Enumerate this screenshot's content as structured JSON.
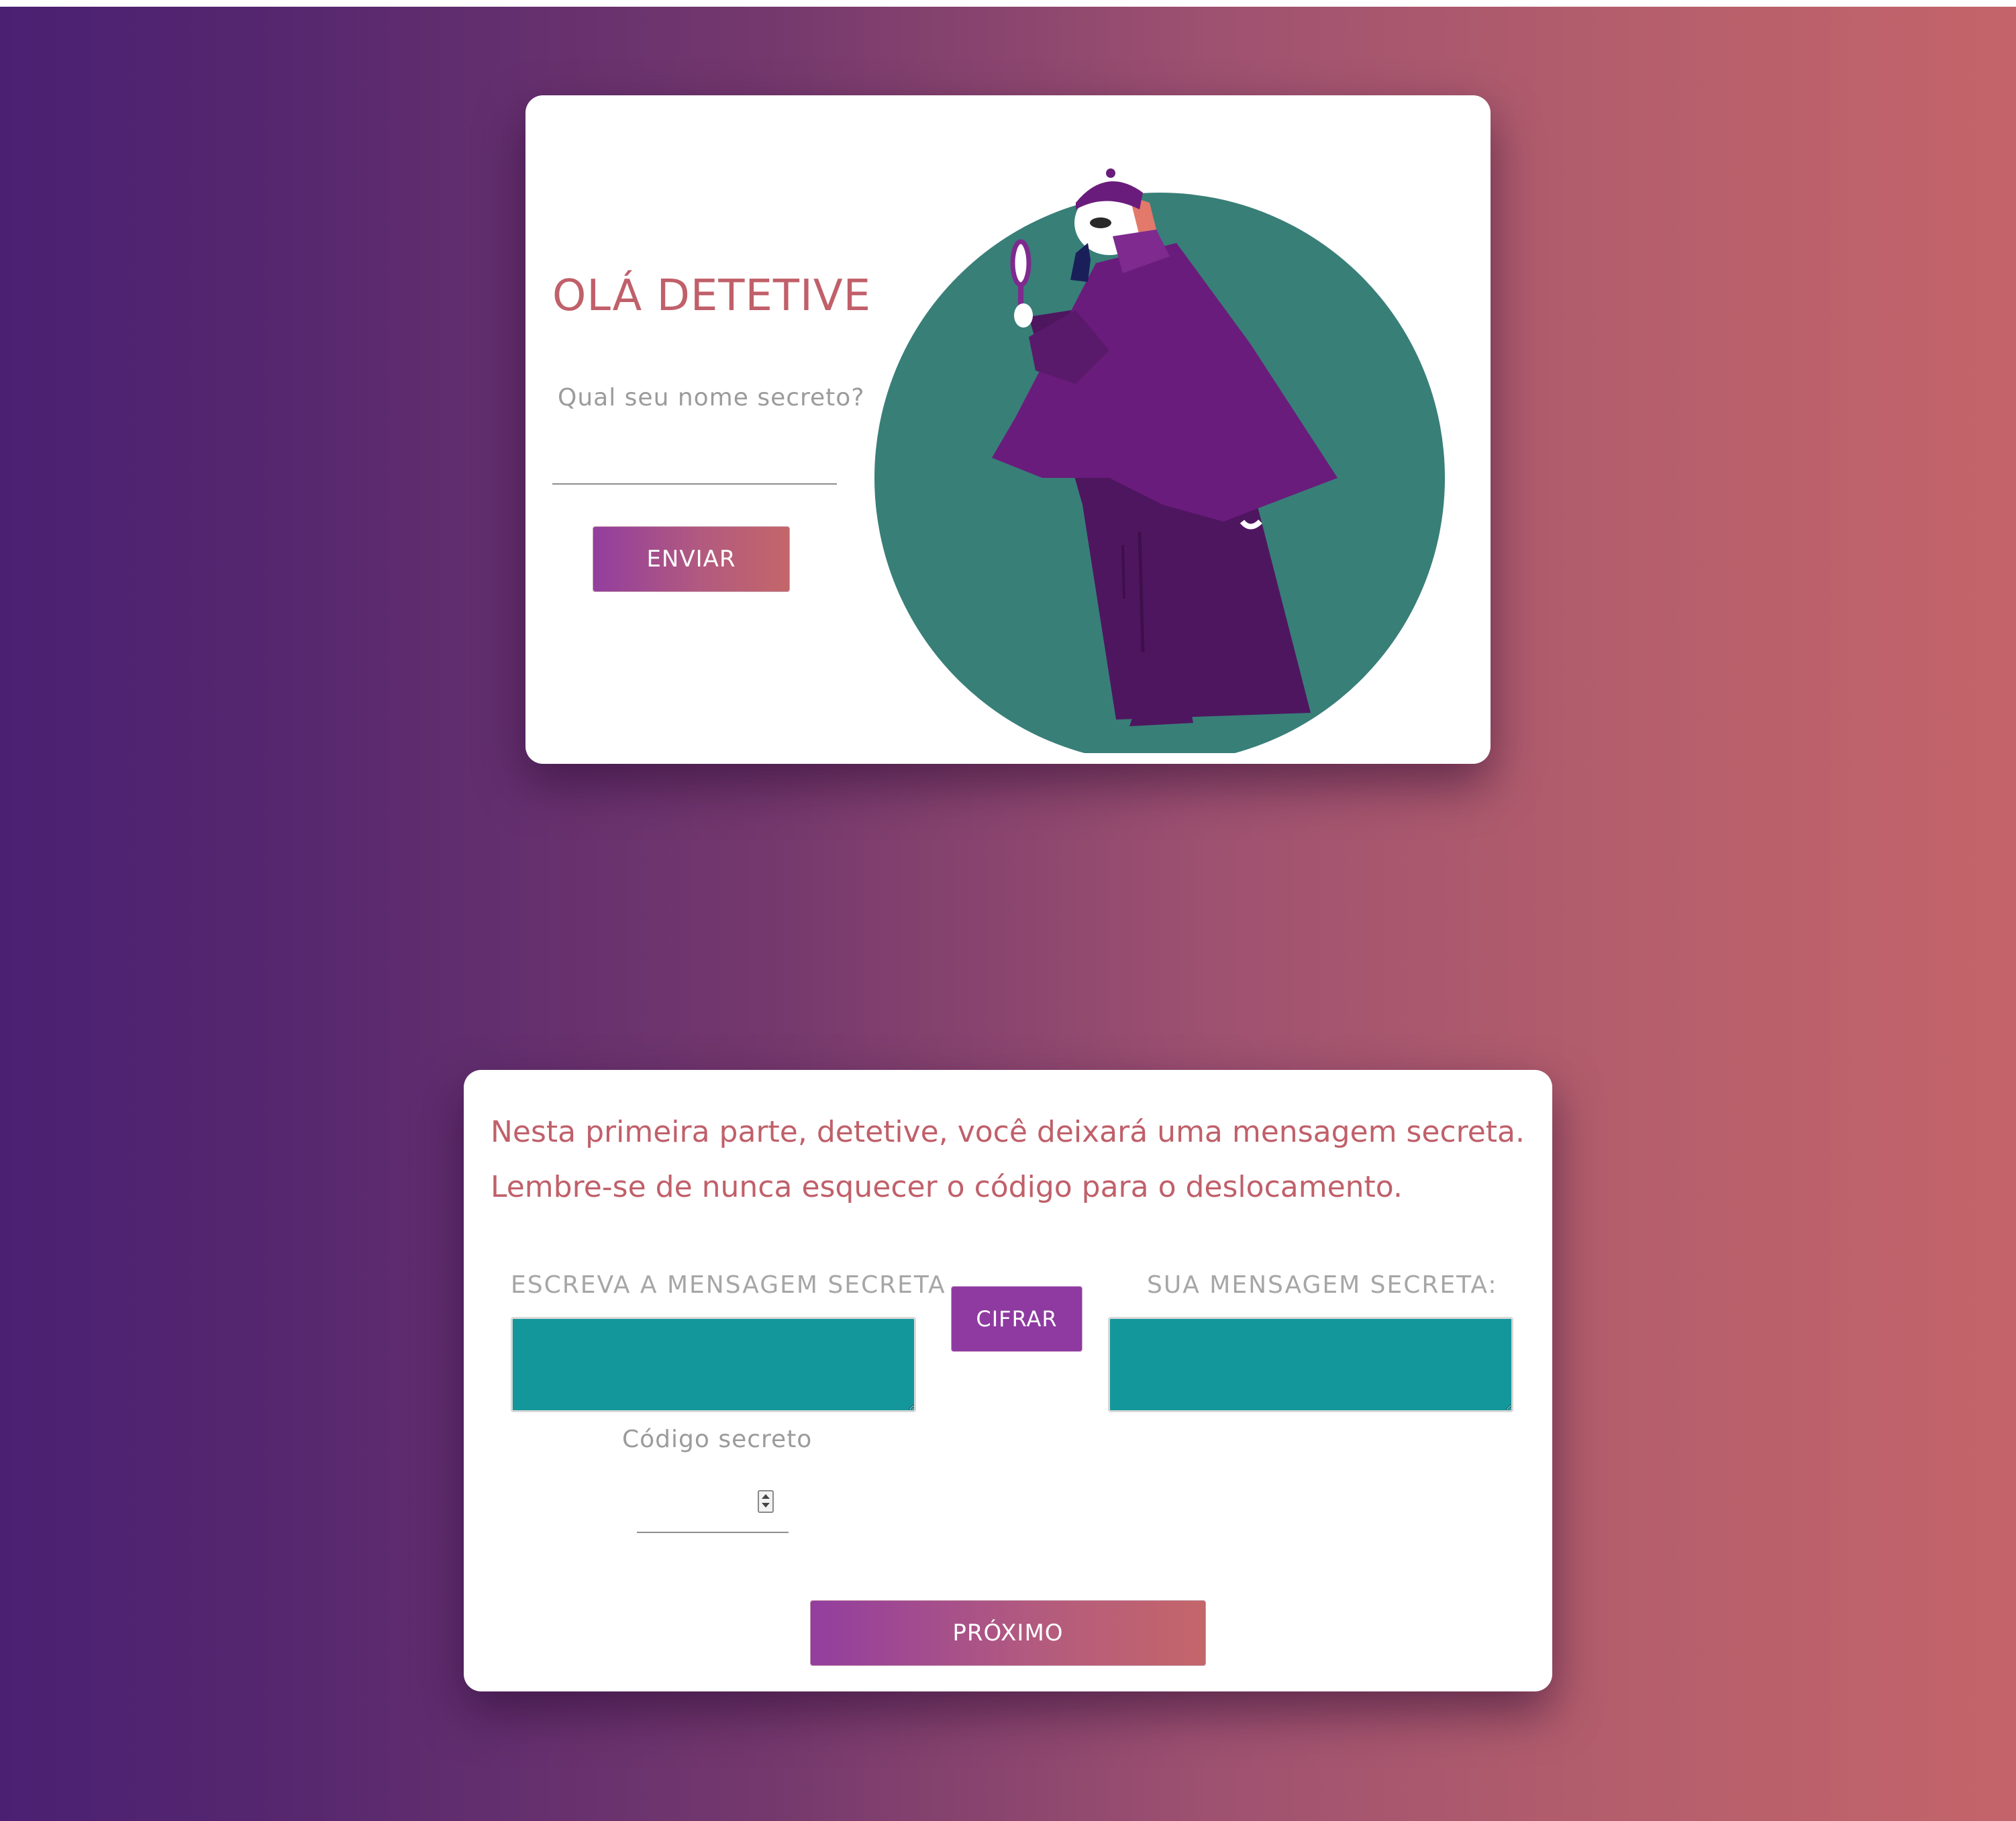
{
  "welcome": {
    "title": "OLÁ DETETIVE",
    "name_prompt": "Qual seu nome secreto?",
    "name_value": "",
    "send_label": "ENVIAR"
  },
  "cipher": {
    "intro_line1": "Nesta primeira parte, detetive, você deixará uma mensagem secreta.",
    "intro_line2": "Lembre-se de nunca esquecer o código para o deslocamento.",
    "message_label": "ESCREVA A MENSAGEM SECRETA",
    "message_value": "",
    "cipher_label": "CIFRAR",
    "result_label": "SUA MENSAGEM SECRETA:",
    "result_value": "",
    "code_label": "Código secreto",
    "code_value": "",
    "next_label": "PRÓXIMO"
  },
  "icons": {
    "illustration": "detective-with-magnifying-glass",
    "spinner": "number-spinner-icon"
  },
  "colors": {
    "accent_text": "#c0606a",
    "teal_area": "#13979a",
    "teal_circle": "#387f78",
    "cipher_button": "#8e3aa0",
    "gradient_start": "#4b2073",
    "gradient_end": "#c4646a",
    "button_gradient_start": "#933e9e",
    "button_gradient_end": "#c4666a"
  }
}
